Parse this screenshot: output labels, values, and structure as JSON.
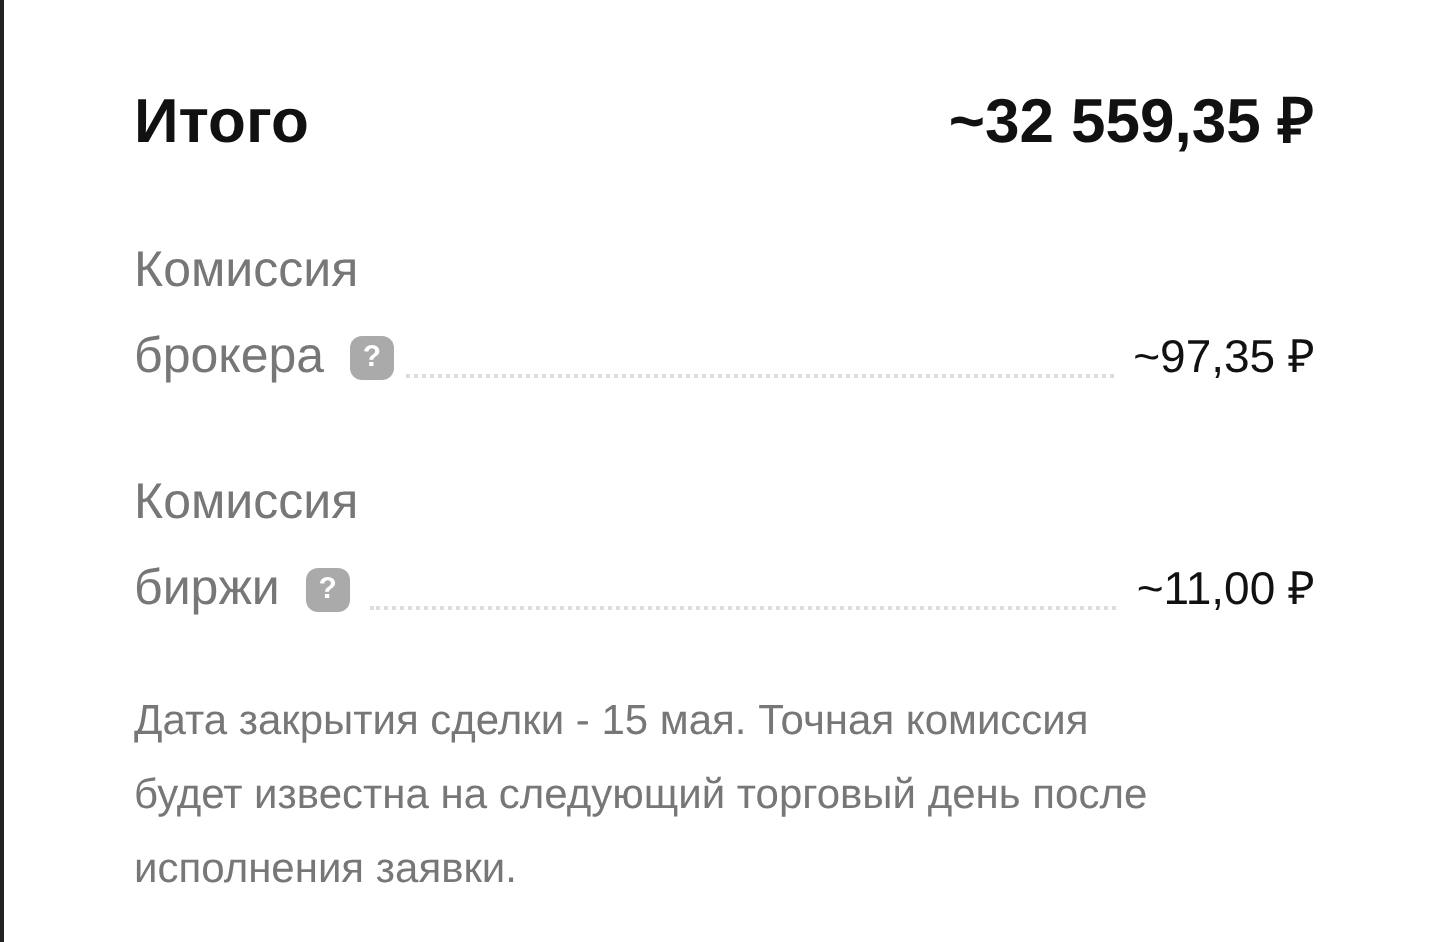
{
  "total": {
    "label": "Итого",
    "amount": "~32 559,35 ₽"
  },
  "fees": [
    {
      "label_lines": [
        "Комиссия",
        "брокера"
      ],
      "help": "?",
      "amount": "~97,35 ₽"
    },
    {
      "label_lines": [
        "Комиссия",
        "биржи"
      ],
      "help": "?",
      "amount": "~11,00 ₽"
    }
  ],
  "note": "Дата закрытия сделки - 15 мая. Точная комиссия будет известна на следующий торговый день после исполнения заявки."
}
